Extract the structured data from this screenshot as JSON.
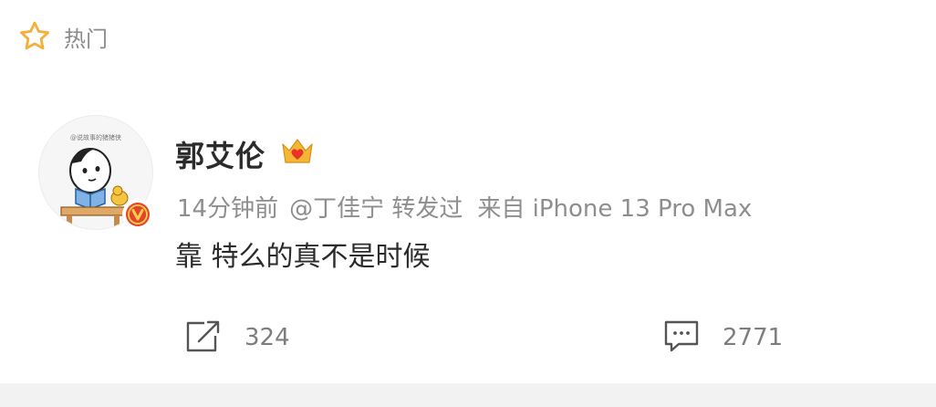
{
  "hot": {
    "label": "热门"
  },
  "post": {
    "user_name": "郭艾伦",
    "time": "14分钟前",
    "forwarded_by": "@丁佳宁 转发过",
    "source": "来自 iPhone 13 Pro Max",
    "text": "靠 特么的真不是时候",
    "avatar_caption": "@说故事的猪猪侠"
  },
  "actions": {
    "repost_count": "324",
    "comment_count": "2771"
  },
  "colors": {
    "star": "#f4b03c",
    "verified": "#e5432c",
    "crown": "#f5b634",
    "text_primary": "#2b2b2b",
    "text_secondary": "#8e8e8e"
  },
  "icons": {
    "hot": "star-outline-icon",
    "verified": "verified-v-icon",
    "badge": "crown-heart-icon",
    "repost": "repost-icon",
    "comment": "comment-icon"
  }
}
